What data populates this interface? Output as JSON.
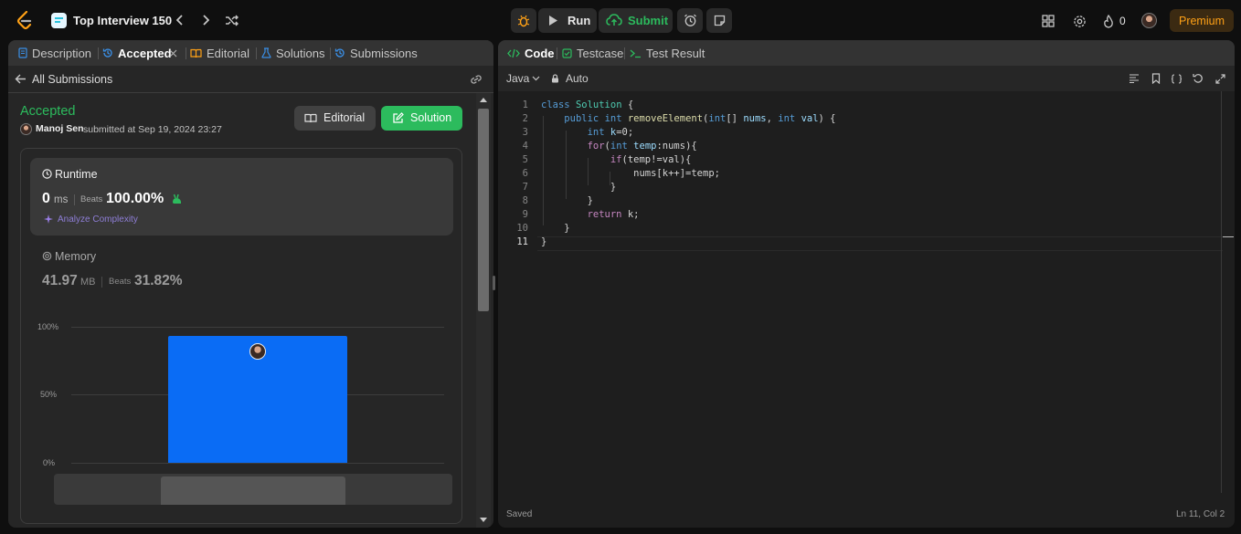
{
  "topbar": {
    "problem_list_title": "Top Interview 150",
    "run_label": "Run",
    "submit_label": "Submit",
    "streak_count": "0",
    "premium_label": "Premium"
  },
  "left_tabs": {
    "description": "Description",
    "accepted": "Accepted",
    "editorial": "Editorial",
    "solutions": "Solutions",
    "submissions": "Submissions"
  },
  "submission": {
    "back_label": "All Submissions",
    "status": "Accepted",
    "user": "Manoj Sen",
    "submitted_text": "submitted at Sep 19, 2024 23:27",
    "editorial_button": "Editorial",
    "solution_button": "Solution"
  },
  "runtime": {
    "title": "Runtime",
    "value": "0",
    "unit": "ms",
    "beats_label": "Beats",
    "beats_value": "100.00%",
    "analyze_label": "Analyze Complexity"
  },
  "memory": {
    "title": "Memory",
    "value": "41.97",
    "unit": "MB",
    "beats_label": "Beats",
    "beats_value": "31.82%"
  },
  "chart_data": {
    "type": "bar",
    "y_ticks": [
      "100%",
      "50%",
      "0%"
    ],
    "ylim": [
      0,
      100
    ],
    "bars": [
      {
        "value": 93,
        "color": "#0a6cf5",
        "highlighted": true
      }
    ]
  },
  "right_tabs": {
    "code": "Code",
    "testcase": "Testcase",
    "test_result": "Test Result"
  },
  "editor": {
    "language": "Java",
    "mode": "Auto",
    "line_numbers": [
      "1",
      "2",
      "3",
      "4",
      "5",
      "6",
      "7",
      "8",
      "9",
      "10",
      "11"
    ],
    "status_saved": "Saved",
    "cursor_position": "Ln 11, Col 2"
  },
  "colors": {
    "accent_green": "#2cbb5d",
    "premium_text": "#ffa116",
    "bar_blue": "#0a6cf5"
  }
}
